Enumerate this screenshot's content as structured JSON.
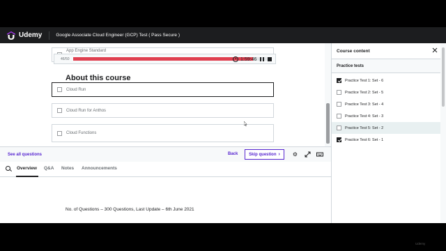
{
  "header": {
    "brand": "Udemy",
    "course_title": "Google Associate Cloud Engineer (GCP) Test ( Pass Secure )"
  },
  "quiz": {
    "progress_label": "46/50",
    "progress_fraction": 0.92,
    "timer": "1:59:46",
    "options": [
      {
        "label": "App Engine Standard",
        "checked": false
      },
      {
        "label": "Cloud Run",
        "checked": false
      },
      {
        "label": "Cloud Run for Anthos",
        "checked": false
      },
      {
        "label": "Cloud Functions",
        "checked": false
      }
    ]
  },
  "actions": {
    "see_all": "See all questions",
    "back": "Back",
    "skip": "Skip question"
  },
  "tabs": [
    "Overview",
    "Q&A",
    "Notes",
    "Announcements"
  ],
  "about": {
    "title": "About this course",
    "text": "No. of Questions – 300 Questions, Last Update – 6th June 2021"
  },
  "sidebar": {
    "title": "Course content",
    "section": "Practice tests",
    "items": [
      {
        "label": "Practice Test 1: Set - 6",
        "checked": true
      },
      {
        "label": "Practice Test 2: Set - 5",
        "checked": false
      },
      {
        "label": "Practice Test 3: Set - 4",
        "checked": false
      },
      {
        "label": "Practice Test 4: Set - 3",
        "checked": false
      },
      {
        "label": "Practice Test 5: Set - 2",
        "checked": false,
        "current": true
      },
      {
        "label": "Practice Test 6: Set - 1",
        "checked": true
      }
    ]
  },
  "colors": {
    "accent": "#5624d0",
    "progress": "#e04050",
    "header_bg": "#1c1d1f"
  },
  "icons": [
    "udemy-logo-icon",
    "clock-icon",
    "pause-icon",
    "stop-icon",
    "gear-icon",
    "expand-icon",
    "keyboard-icon",
    "search-icon",
    "close-icon"
  ],
  "watermark": "Udemy"
}
